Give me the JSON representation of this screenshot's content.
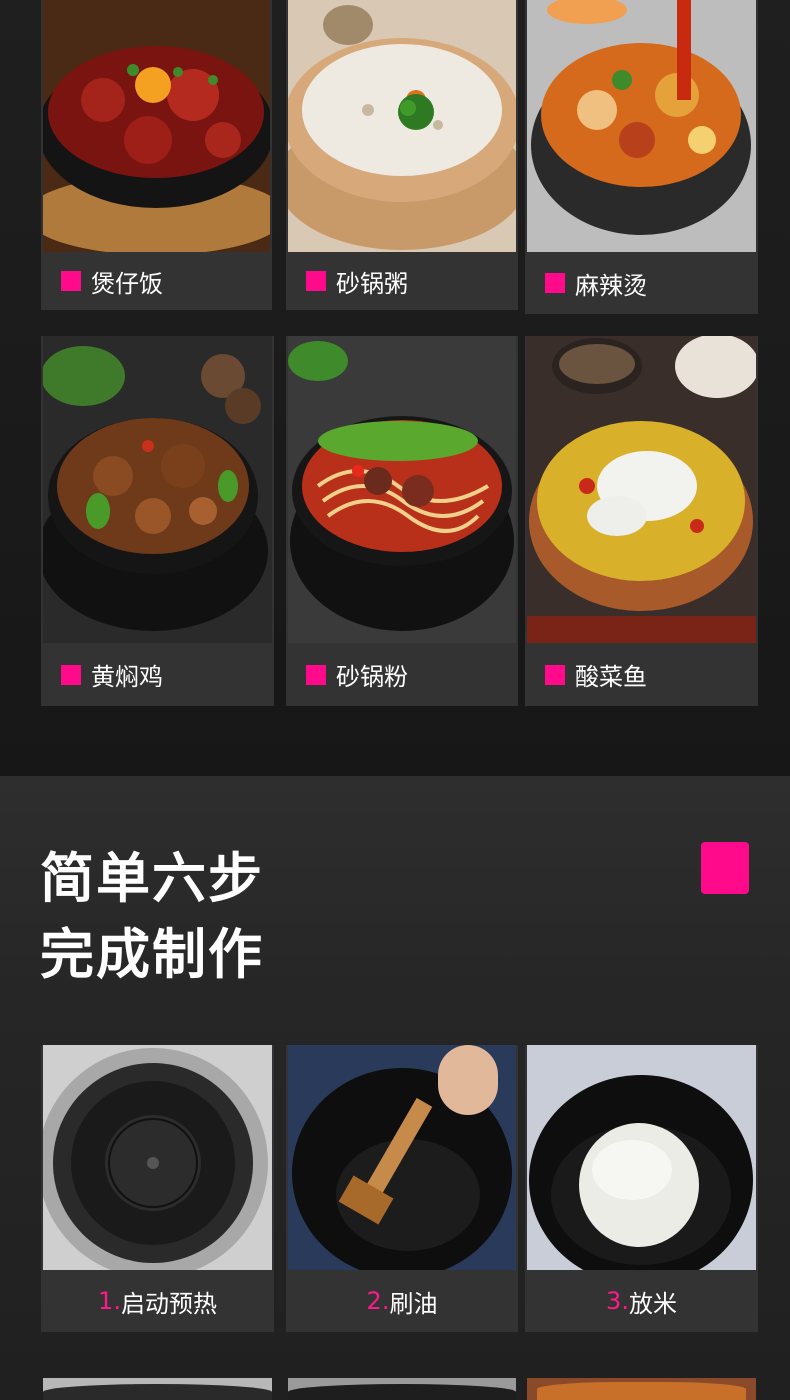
{
  "dishes": [
    {
      "label": "煲仔饭",
      "icon": "clay-pot-rice"
    },
    {
      "label": "砂锅粥",
      "icon": "clay-pot-congee"
    },
    {
      "label": "麻辣烫",
      "icon": "spicy-hot-pot"
    },
    {
      "label": "黄焖鸡",
      "icon": "braised-chicken"
    },
    {
      "label": "砂锅粉",
      "icon": "clay-pot-noodles"
    },
    {
      "label": "酸菜鱼",
      "icon": "pickled-cabbage-fish"
    }
  ],
  "steps_section": {
    "title_line1": "简单六步",
    "title_line2": "完成制作",
    "accent_color": "#ff0a8a"
  },
  "steps": [
    {
      "number": "1.",
      "label": "启动预热"
    },
    {
      "number": "2.",
      "label": "刷油"
    },
    {
      "number": "3.",
      "label": "放米"
    }
  ],
  "colors": {
    "accent": "#ff0a8a",
    "card_bg": "#333333",
    "page_bg": "#1b1b1b"
  }
}
